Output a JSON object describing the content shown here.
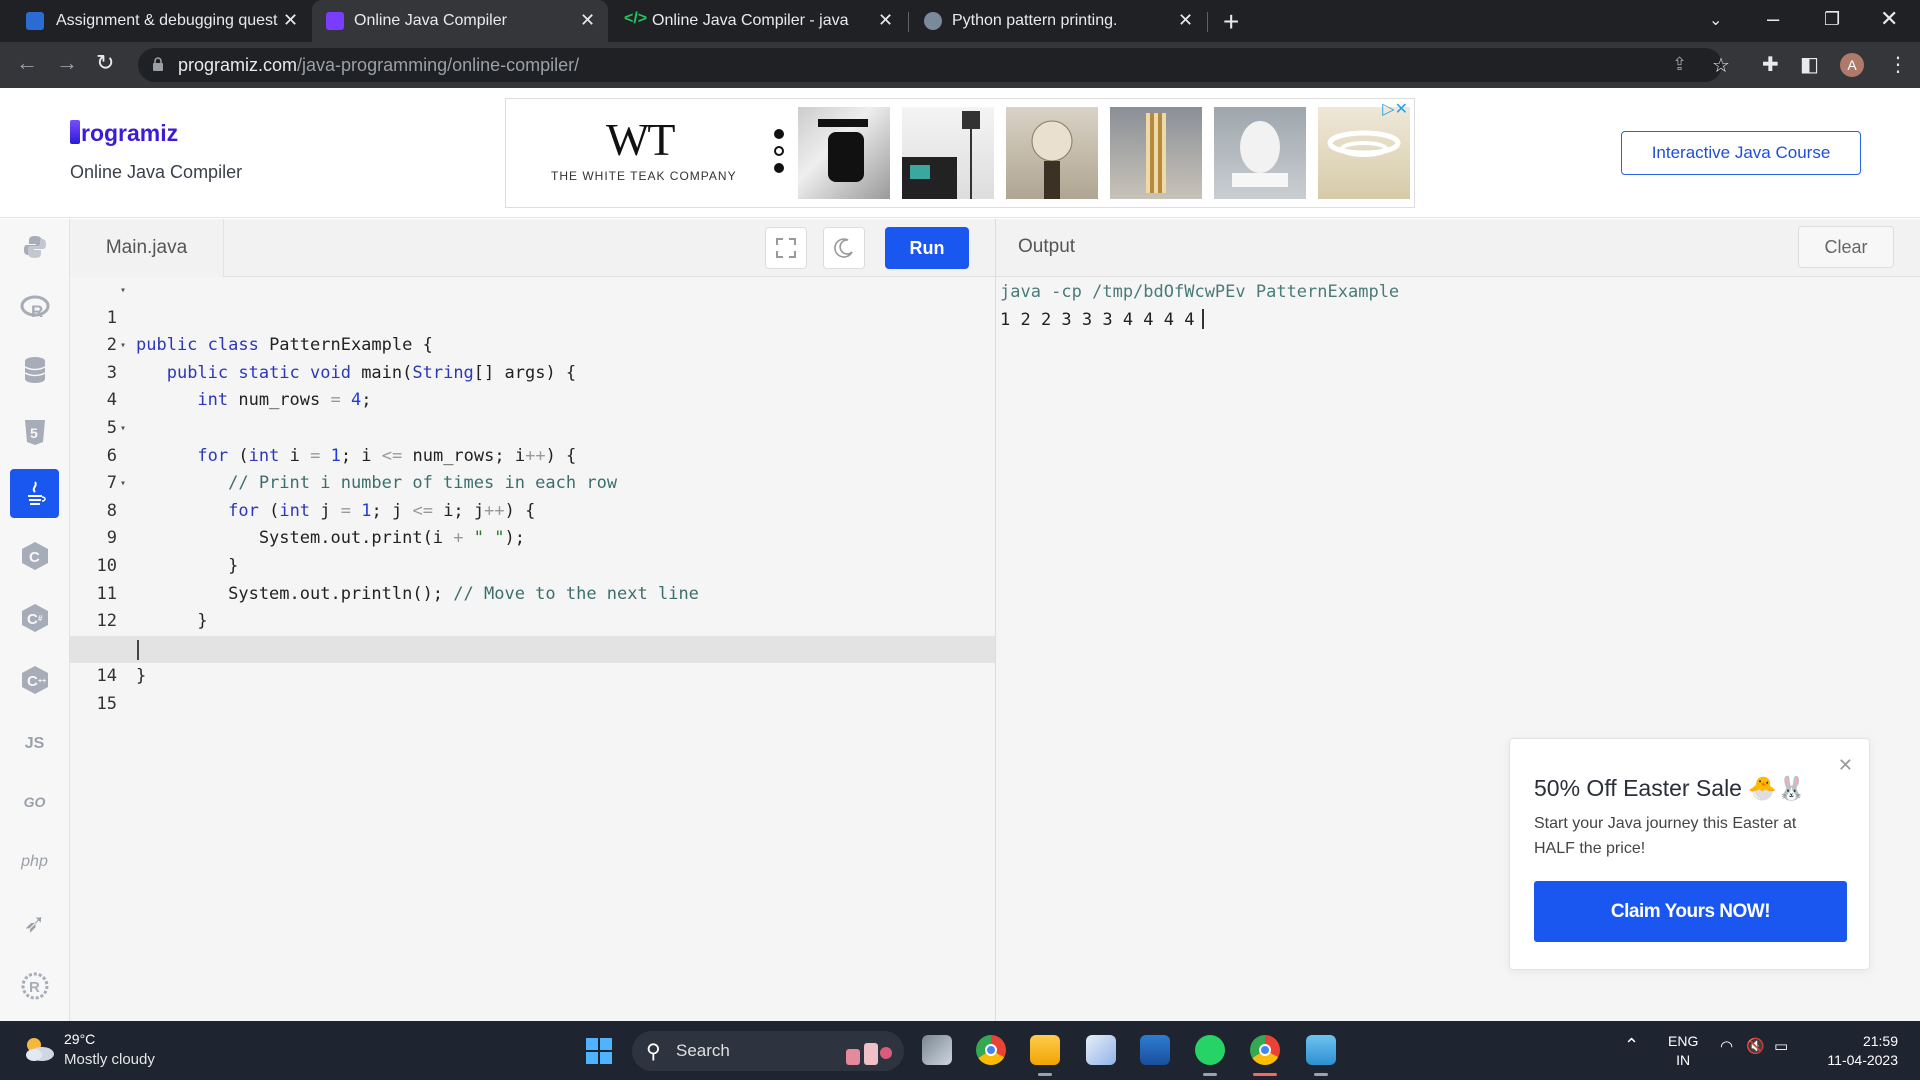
{
  "browser": {
    "tabs": [
      {
        "title": "Assignment & debugging questi",
        "favicon_color": "#2b6cd4"
      },
      {
        "title": "Online Java Compiler",
        "favicon_color": "#7a3cff"
      },
      {
        "title": "Online Java Compiler - java",
        "favicon_color": "#22a34b"
      },
      {
        "title": "Python pattern printing.",
        "favicon_color": "#7a8a9a"
      }
    ],
    "active_tab": 1,
    "url_host": "programiz.com",
    "url_path": "/java-programming/online-compiler/",
    "profile_initial": "A"
  },
  "header": {
    "logo_text": "rogramiz",
    "subtitle": "Online Java Compiler",
    "course_button": "Interactive Java Course",
    "ad": {
      "brand_mark": "WT",
      "brand_name": "THE WHITE TEAK COMPANY"
    }
  },
  "sidebar": {
    "languages": [
      {
        "name": "python-icon",
        "glyph": "🐍"
      },
      {
        "name": "r-icon",
        "glyph": "R"
      },
      {
        "name": "sql-icon",
        "glyph": "≡"
      },
      {
        "name": "html-icon",
        "glyph": "5"
      },
      {
        "name": "java-icon",
        "glyph": "☕"
      },
      {
        "name": "c-icon",
        "glyph": "C"
      },
      {
        "name": "csharp-icon",
        "glyph": "C"
      },
      {
        "name": "cpp-icon",
        "glyph": "C"
      },
      {
        "name": "js-icon",
        "glyph": "JS"
      },
      {
        "name": "go-icon",
        "glyph": "GO"
      },
      {
        "name": "php-icon",
        "glyph": "php"
      },
      {
        "name": "swift-icon",
        "glyph": "➶"
      },
      {
        "name": "rust-icon",
        "glyph": "R"
      }
    ],
    "active_index": 4
  },
  "editor": {
    "file_name": "Main.java",
    "run_label": "Run",
    "current_line": 14,
    "lines": [
      "public class PatternExample {",
      "    public static void main(String[] args) {",
      "        int num_rows = 4;",
      "",
      "        for (int i = 1; i <= num_rows; i++) {",
      "            // Print i number of times in each row",
      "            for (int j = 1; j <= i; j++) {",
      "                System.out.print(i + \" \");",
      "            }",
      "            System.out.println(); // Move to the next line",
      "        }",
      "    }",
      "}",
      "",
      ""
    ],
    "foldable_lines": [
      1,
      2,
      5,
      7
    ]
  },
  "output": {
    "title": "Output",
    "clear_label": "Clear",
    "command": "java -cp /tmp/bdOfWcwPEv PatternExample",
    "result": "1 2 2 3 3 3 4 4 4 4"
  },
  "promo": {
    "title": "50% Off Easter Sale 🐣🐰",
    "text": "Start your Java journey this Easter at HALF the price!",
    "button": "Claim Yours NOW!"
  },
  "taskbar": {
    "temperature": "29°C",
    "weather": "Mostly cloudy",
    "search_label": "Search",
    "lang_line1": "ENG",
    "lang_line2": "IN",
    "time": "21:59",
    "date": "11-04-2023"
  },
  "colors": {
    "accent": "#1a56f0",
    "tab_bg": "#202124",
    "toolbar_bg": "#35363a",
    "taskbar_bg": "#1f2530"
  }
}
